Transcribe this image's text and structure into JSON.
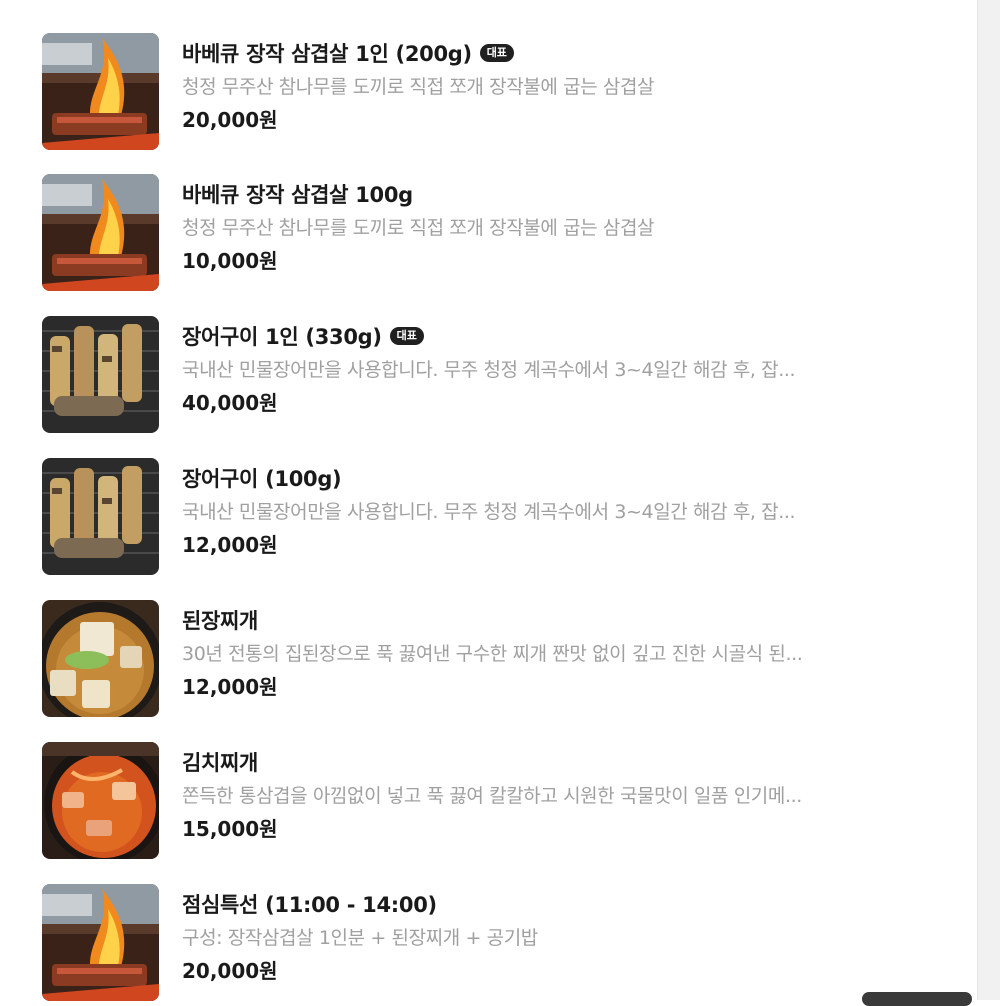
{
  "menu": {
    "items": [
      {
        "name": "바베큐 장작 삼겹살 1인 (200g)",
        "badge": "대표",
        "description": "청정 무주산 참나무를 도끼로 직접 쪼개 장작불에 굽는 삼겹살",
        "price": "20,000원",
        "image": "grilled-pork-fire-photo"
      },
      {
        "name": "바베큐 장작 삼겹살 100g",
        "badge": "",
        "description": "청정 무주산 참나무를 도끼로 직접 쪼개 장작불에 굽는 삼겹살",
        "price": "10,000원",
        "image": "grilled-pork-fire-photo"
      },
      {
        "name": "장어구이 1인 (330g)",
        "badge": "대표",
        "description": "국내산 민물장어만을 사용합니다. 무주 청정 계곡수에서 3~4일간 해감 후, 잡...",
        "price": "40,000원",
        "image": "grilled-eel-photo"
      },
      {
        "name": "장어구이 (100g)",
        "badge": "",
        "description": "국내산 민물장어만을 사용합니다. 무주 청정 계곡수에서 3~4일간 해감 후, 잡...",
        "price": "12,000원",
        "image": "grilled-eel-photo"
      },
      {
        "name": "된장찌개",
        "badge": "",
        "description": "30년 전통의 집된장으로 푹 끓여낸 구수한 찌개 짠맛 없이 깊고 진한 시골식 된...",
        "price": "12,000원",
        "image": "soybean-stew-photo"
      },
      {
        "name": "김치찌개",
        "badge": "",
        "description": "쫀득한 통삼겹을 아낌없이 넣고 푹 끓여 칼칼하고 시원한 국물맛이 일품 인기메...",
        "price": "15,000원",
        "image": "kimchi-stew-photo"
      },
      {
        "name": "점심특선 (11:00 - 14:00)",
        "badge": "",
        "description": "구성: 장작삼겹살 1인분 + 된장찌개 + 공기밥",
        "price": "20,000원",
        "image": "grilled-pork-fire-photo"
      }
    ]
  }
}
